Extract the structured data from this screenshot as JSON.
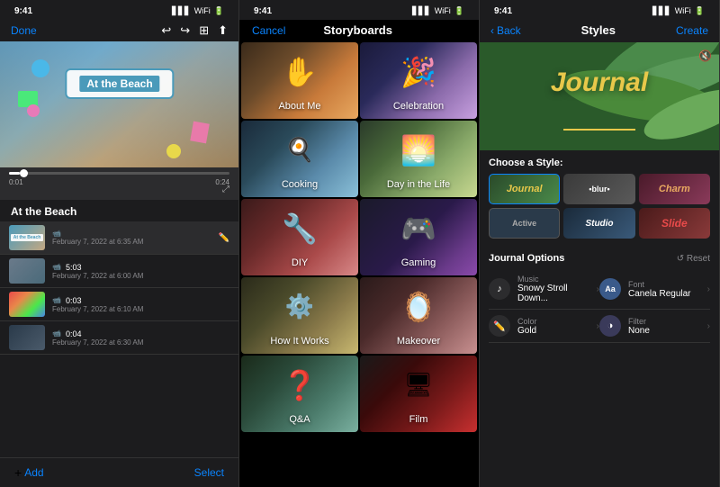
{
  "panel1": {
    "status_time": "9:41",
    "done_btn": "Done",
    "add_btn": "Add",
    "select_btn": "Select",
    "title": "At the Beach",
    "time_start": "0:01",
    "time_end": "0:24",
    "clips": [
      {
        "name": "At the Beach",
        "date": "February 7, 2022 at 6:35 AM",
        "type": "beach",
        "active": true
      },
      {
        "name": "",
        "date": "February 7, 2022 at 6:00 AM",
        "type": "people",
        "active": false,
        "duration": "5:03"
      },
      {
        "name": "",
        "date": "February 7, 2022 at 6:10 AM",
        "type": "color",
        "active": false,
        "duration": "0:03"
      },
      {
        "name": "",
        "date": "February 7, 2022 at 6:30 AM",
        "type": "night",
        "active": false,
        "duration": "0:04"
      }
    ]
  },
  "panel2": {
    "status_time": "9:41",
    "cancel_btn": "Cancel",
    "title": "Storyboards",
    "cells": [
      {
        "id": "about",
        "label": "About Me",
        "icon": "✋"
      },
      {
        "id": "celebration",
        "label": "Celebration",
        "icon": "🎉"
      },
      {
        "id": "cooking",
        "label": "Cooking",
        "icon": "🍳"
      },
      {
        "id": "day",
        "label": "Day in the Life",
        "icon": "🌅"
      },
      {
        "id": "diy",
        "label": "DIY",
        "icon": "🔧"
      },
      {
        "id": "gaming",
        "label": "Gaming",
        "icon": "🎮"
      },
      {
        "id": "howit",
        "label": "How It Works",
        "icon": "⚙️"
      },
      {
        "id": "makeover",
        "label": "Makeover",
        "icon": "🪞"
      },
      {
        "id": "qa",
        "label": "Q&A",
        "icon": "❓"
      },
      {
        "id": "film",
        "label": "Film",
        "icon": "🎬"
      }
    ]
  },
  "panel3": {
    "status_time": "9:41",
    "back_btn": "Back",
    "title": "Styles",
    "create_btn": "Create",
    "journal_title": "Journal",
    "choose_style_label": "Choose a Style:",
    "styles": [
      {
        "id": "journal",
        "label": "Journal"
      },
      {
        "id": "blur",
        "label": "•blur•"
      },
      {
        "id": "charm",
        "label": "Charm"
      },
      {
        "id": "active",
        "label": "Active"
      },
      {
        "id": "studio",
        "label": "Studio"
      },
      {
        "id": "slide",
        "label": "Slide"
      }
    ],
    "options_label": "Journal Options",
    "reset_btn": "↺ Reset",
    "options": [
      {
        "id": "music",
        "label": "Music",
        "value": "Snowy Stroll Down..."
      },
      {
        "id": "font",
        "label": "Font",
        "value": "Canela Regular"
      },
      {
        "id": "color",
        "label": "Color",
        "value": "Gold"
      },
      {
        "id": "filter",
        "label": "Filter",
        "value": "None"
      }
    ]
  }
}
